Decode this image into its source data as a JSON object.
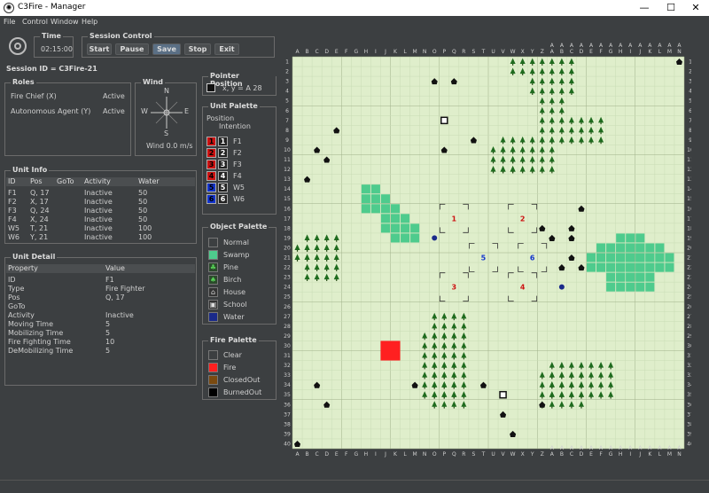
{
  "window": {
    "title": "C3Fire - Manager",
    "minimize": "—",
    "maximize": "☐",
    "close": "✕"
  },
  "menu": [
    "File",
    "Control",
    "Window",
    "Help"
  ],
  "time": {
    "title": "Time",
    "value": "02:15:00"
  },
  "session_control": {
    "title": "Session Control",
    "start": "Start",
    "pause": "Pause",
    "save": "Save",
    "stop": "Stop",
    "exit": "Exit"
  },
  "session_id": "Session ID = C3Fire-21",
  "roles": {
    "title": "Roles",
    "items": [
      {
        "name": "Fire Chief   (X)",
        "status": "Active"
      },
      {
        "name": "Autonomous Agent  (Y)",
        "status": "Active"
      }
    ]
  },
  "wind": {
    "title": "Wind",
    "n": "N",
    "s": "S",
    "e": "E",
    "w": "W",
    "text": "Wind 0.0 m/s"
  },
  "pointer_position": {
    "title": "Pointer Position",
    "text": "x, y =   A 28"
  },
  "unit_palette": {
    "title": "Unit Palette",
    "position": "Position",
    "intention": "Intention",
    "units": [
      "F1",
      "F2",
      "F3",
      "F4",
      "W5",
      "W6"
    ],
    "numbers": [
      "1",
      "2",
      "3",
      "4",
      "5",
      "6"
    ]
  },
  "unit_info": {
    "title": "Unit Info",
    "headers": [
      "ID",
      "Pos",
      "GoTo",
      "Activity",
      "Water"
    ],
    "rows": [
      [
        "F1",
        "Q, 17",
        "",
        "Inactive",
        "50"
      ],
      [
        "F2",
        "X, 17",
        "",
        "Inactive",
        "50"
      ],
      [
        "F3",
        "Q, 24",
        "",
        "Inactive",
        "50"
      ],
      [
        "F4",
        "X, 24",
        "",
        "Inactive",
        "50"
      ],
      [
        "W5",
        "T, 21",
        "",
        "Inactive",
        "100"
      ],
      [
        "W6",
        "Y, 21",
        "",
        "Inactive",
        "100"
      ]
    ]
  },
  "unit_detail": {
    "title": "Unit Detail",
    "headers": [
      "Property",
      "Value"
    ],
    "rows": [
      [
        "ID",
        "F1"
      ],
      [
        "Type",
        "Fire Fighter"
      ],
      [
        "Pos",
        "Q, 17"
      ],
      [
        "GoTo",
        ""
      ],
      [
        "Activity",
        "Inactive"
      ],
      [
        "Moving Time",
        "5"
      ],
      [
        "Mobilizing Time",
        "5"
      ],
      [
        "Fire Fighting Time",
        "10"
      ],
      [
        "DeMobilizing Time",
        "5"
      ]
    ]
  },
  "object_palette": {
    "title": "Object Palette",
    "items": [
      "Normal",
      "Swamp",
      "Pine",
      "Birch",
      "House",
      "School",
      "Water"
    ]
  },
  "fire_palette": {
    "title": "Fire Palette",
    "items": [
      "Clear",
      "Fire",
      "ClosedOut",
      "BurnedOut"
    ]
  },
  "colors": {
    "swamp": "#4ecb8d",
    "pine": "#1e6b1e",
    "fire": "#ff2020",
    "closedout": "#7a4a10",
    "burnedout": "#000000",
    "map_bg": "#dfeecb",
    "unit_red": "#cc1111",
    "unit_blue": "#1133cc"
  },
  "map": {
    "columns": [
      "A",
      "B",
      "C",
      "D",
      "E",
      "F",
      "G",
      "H",
      "I",
      "J",
      "K",
      "L",
      "M",
      "N",
      "O",
      "P",
      "Q",
      "R",
      "S",
      "T",
      "U",
      "V",
      "W",
      "X",
      "Y",
      "Z",
      "AA",
      "AB",
      "AC",
      "AD",
      "AE",
      "AF",
      "AG",
      "AH",
      "AI",
      "AJ",
      "AK",
      "AL",
      "AM",
      "AN"
    ],
    "rows": 40,
    "units": [
      {
        "label": "1",
        "col": "Q",
        "row": 17,
        "kind": "fire"
      },
      {
        "label": "2",
        "col": "X",
        "row": 17,
        "kind": "fire"
      },
      {
        "label": "3",
        "col": "Q",
        "row": 24,
        "kind": "fire"
      },
      {
        "label": "4",
        "col": "X",
        "row": 24,
        "kind": "fire"
      },
      {
        "label": "5",
        "col": "T",
        "row": 21,
        "kind": "water"
      },
      {
        "label": "6",
        "col": "Y",
        "row": 21,
        "kind": "water"
      }
    ]
  }
}
